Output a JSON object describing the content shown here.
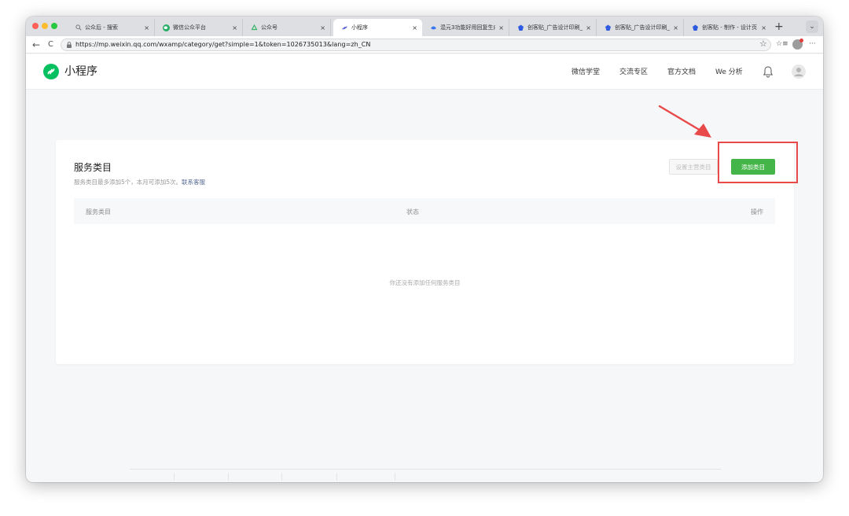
{
  "browser": {
    "tabs": [
      {
        "title": "公众后 - 搜索",
        "icon": "search-icon",
        "active": false
      },
      {
        "title": "微信公众平台",
        "icon": "wechat-icon",
        "active": false
      },
      {
        "title": "公众号",
        "icon": "recycle-icon",
        "active": false
      },
      {
        "title": "小程序",
        "icon": "miniprogram-icon",
        "active": true
      },
      {
        "title": "混元3功能好用回复生成",
        "icon": "hunyuan-icon",
        "active": false
      },
      {
        "title": "创客贴_广告设计印刷_图",
        "icon": "chuangkit-icon",
        "active": false
      },
      {
        "title": "创客贴_广告设计印刷_图",
        "icon": "chuangkit-icon",
        "active": false
      },
      {
        "title": "创客贴 - 制作 - 设计页",
        "icon": "chuangkit-icon",
        "active": false
      }
    ],
    "close_glyph": "×",
    "new_tab_glyph": "+",
    "tab_menu_glyph": "⌄",
    "back_glyph": "←",
    "reload_glyph": "C",
    "url": "https://mp.weixin.qq.com/wxamp/category/get?simple=1&token=1026735013&lang=zh_CN",
    "star_glyph": "☆",
    "reading_list_glyph": "☆≡",
    "more_glyph": "···"
  },
  "header": {
    "brand": "小程序",
    "nav": [
      "微信学堂",
      "交流专区",
      "官方文档",
      "We 分析"
    ]
  },
  "card": {
    "title": "服务类目",
    "subtitle": "服务类目最多添加5个，本月可添加5次。",
    "contact_link": "联系客服",
    "secondary_button": "设置主营类目",
    "primary_button": "添加类目",
    "columns": [
      "服务类目",
      "状态",
      "操作"
    ],
    "empty_text": "你还没有添加任何服务类目"
  },
  "colors": {
    "accent_green": "#44b549",
    "brand_green": "#07c160",
    "link": "#576b95",
    "annotation_red": "#e84a4a"
  }
}
